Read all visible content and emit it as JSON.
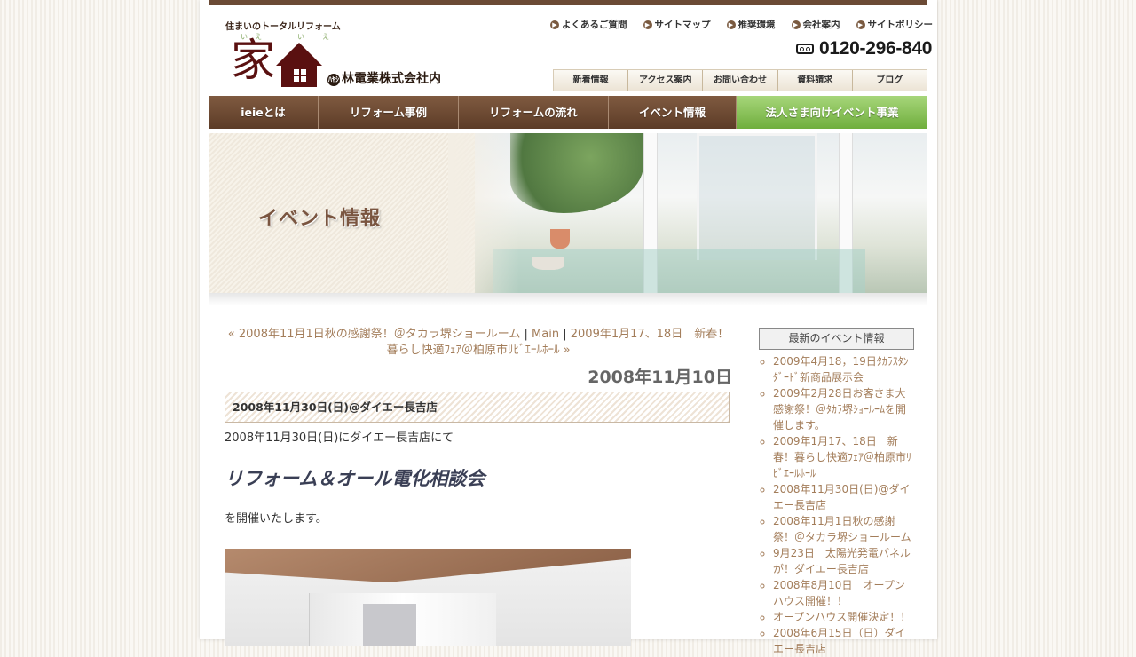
{
  "header": {
    "tagline": "住まいのトータルリフォーム",
    "logo_kanji": "家",
    "logo_furi_1": "い",
    "logo_furi_2": "え",
    "logo_furi_3": "い",
    "logo_furi_4": "え",
    "logo_mark": "ﾊﾔｼ",
    "company": "林電業株式会社内",
    "phone": "0120-296-840"
  },
  "util_nav": [
    {
      "label": "よくあるご質問"
    },
    {
      "label": "サイトマップ"
    },
    {
      "label": "推奨環境"
    },
    {
      "label": "会社案内"
    },
    {
      "label": "サイトポリシー"
    }
  ],
  "sub_nav": [
    {
      "label": "新着情報"
    },
    {
      "label": "アクセス案内"
    },
    {
      "label": "お問い合わせ"
    },
    {
      "label": "資料請求"
    },
    {
      "label": "ブログ"
    }
  ],
  "main_nav": [
    {
      "label": "ieieとは"
    },
    {
      "label": "リフォーム事例"
    },
    {
      "label": "リフォームの流れ"
    },
    {
      "label": "イベント情報"
    },
    {
      "label": "法人さま向けイベント事業"
    }
  ],
  "banner": {
    "title": "イベント情報"
  },
  "post_nav": {
    "prev": "« 2008年11月1日秋の感謝祭！＠タカラ堺ショールーム",
    "sep1": " | ",
    "main": "Main",
    "sep2": " | ",
    "next": "2009年1月17、18日　新春！暮らし快適ﾌｪｱ＠柏原市ﾘﾋﾞｴｰﾙﾎｰﾙ »"
  },
  "entry": {
    "date": "2008年11月10日",
    "title": "2008年11月30日(日)@ダイエー長吉店",
    "body1": "2008年11月30日(日)にダイエー長吉店にて",
    "heading": "リフォーム＆オール電化相談会",
    "body2": "を開催いたします。"
  },
  "sidebar": {
    "heading": "最新のイベント情報",
    "items": [
      "2009年4月18，19日ﾀｶﾗｽﾀﾝﾀﾞｰﾄﾞ新商品展示会",
      "2009年2月28日お客さま大感謝祭！＠ﾀｶﾗ堺ｼｮｰﾙｰﾑを開催します。",
      "2009年1月17、18日　新春！暮らし快適ﾌｪｱ＠柏原市ﾘﾋﾞｴｰﾙﾎｰﾙ",
      "2008年11月30日(日)@ダイエー長吉店",
      "2008年11月1日秋の感謝祭！＠タカラ堺ショールーム",
      "9月23日　太陽光発電パネルが！ダイエー長吉店",
      "2008年8月10日　オープンハウス開催！！",
      "オープンハウス開催決定！！",
      "2008年6月15日（日）ダイエー長吉店"
    ]
  },
  "colors": {
    "brand_brown": "#6b4a35",
    "link": "#a37d5a",
    "nav_green": "#8cc35a"
  }
}
